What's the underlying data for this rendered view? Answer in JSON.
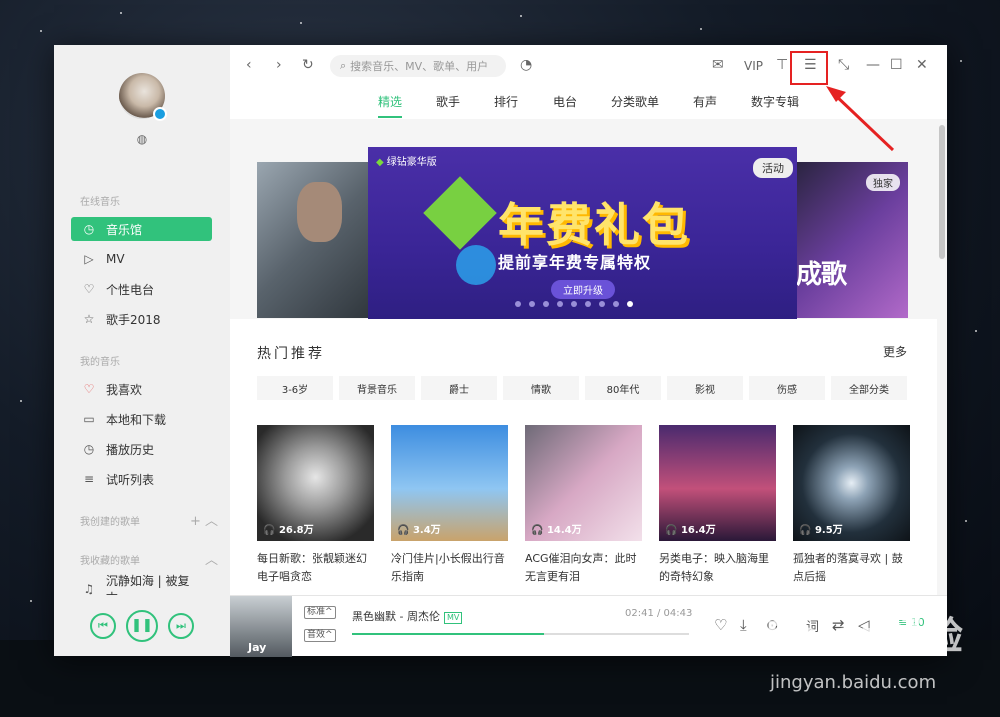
{
  "sidebar": {
    "sections": {
      "online": "在线音乐",
      "mine": "我的音乐",
      "created": "我创建的歌单",
      "collected": "我收藏的歌单"
    },
    "online_items": [
      {
        "label": "音乐馆",
        "icon": "music-hall-icon",
        "glyph": "◷"
      },
      {
        "label": "MV",
        "icon": "mv-icon",
        "glyph": "▷"
      },
      {
        "label": "个性电台",
        "icon": "radio-heart-icon",
        "glyph": "♡"
      },
      {
        "label": "歌手2018",
        "icon": "star-icon",
        "glyph": "☆"
      }
    ],
    "my_items": [
      {
        "label": "我喜欢",
        "icon": "heart-icon",
        "glyph": "♡"
      },
      {
        "label": "本地和下载",
        "icon": "monitor-icon",
        "glyph": "▭"
      },
      {
        "label": "播放历史",
        "icon": "clock-icon",
        "glyph": "◷"
      },
      {
        "label": "试听列表",
        "icon": "playlist-icon",
        "glyph": "≡"
      }
    ],
    "collected_item": "沉静如海 | 被复古..."
  },
  "topbar": {
    "search_placeholder": "搜索音乐、MV、歌单、用户",
    "vip": "VIP"
  },
  "tabs": [
    "精选",
    "歌手",
    "排行",
    "电台",
    "分类歌单",
    "有声",
    "数字专辑"
  ],
  "banner": {
    "brand": "绿钻豪华版",
    "tag": "活动",
    "headline": "年费礼包",
    "subline": "提前享年费专属特权",
    "cta": "立即升级",
    "right_tag": "独家",
    "right_text": "成歌"
  },
  "hot": {
    "title": "热门推荐",
    "more": "更多",
    "categories": [
      "3-6岁",
      "背景音乐",
      "爵士",
      "情歌",
      "80年代",
      "影视",
      "伤感",
      "全部分类"
    ],
    "cards": [
      {
        "count": "26.8万",
        "title": "每日新歌：张靓颖迷幻电子唱贪恋"
      },
      {
        "count": "3.4万",
        "title": "冷门佳片|小长假出行音乐指南"
      },
      {
        "count": "14.4万",
        "title": "ACG催泪向女声：此时无言更有泪"
      },
      {
        "count": "16.4万",
        "title": "另类电子：映入脑海里的奇特幻象"
      },
      {
        "count": "9.5万",
        "title": "孤独者的落寞寻欢 | 鼓点后摇"
      }
    ]
  },
  "player": {
    "album_text": "Jay",
    "quality": "标准",
    "effect": "音效",
    "song": "黑色幽默 - 周杰伦",
    "mv": "MV",
    "time": "02:41 / 04:43",
    "progress": 0.57,
    "lyrics": "词",
    "queue_count": "10"
  },
  "watermark": {
    "logo": "Baidu经验",
    "url": "jingyan.baidu.com"
  },
  "colors": {
    "accent": "#31c27c",
    "highlight": "#e52222"
  }
}
